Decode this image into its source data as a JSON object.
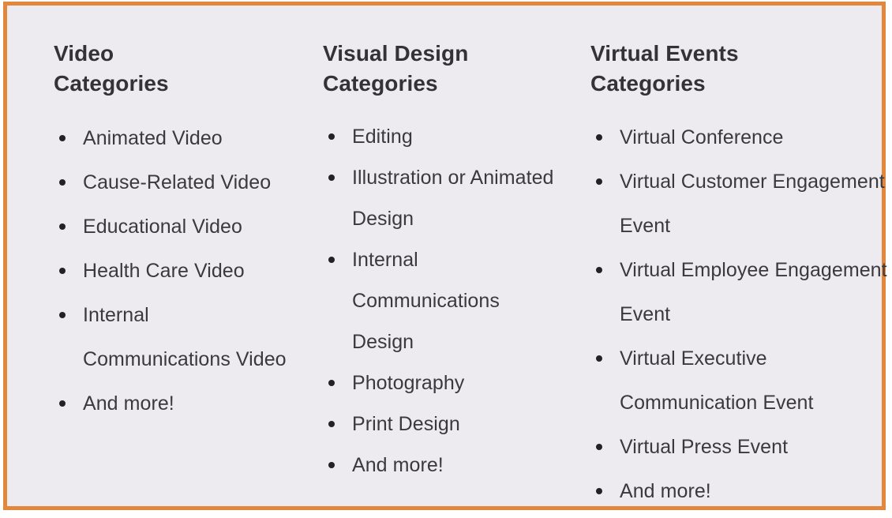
{
  "panel": {
    "border_color": "#e3873c",
    "background_color": "#edebf0",
    "text_color": "#3a3a3d",
    "heading_color": "#333337",
    "bullet_color": "#222225"
  },
  "columns": [
    {
      "heading": "Video Categories",
      "items": [
        "Animated Video",
        "Cause-Related Video",
        "Educational Video",
        "Health Care Video",
        "Internal Communications Video",
        "And more!"
      ]
    },
    {
      "heading": "Visual Design Categories",
      "items": [
        "Editing",
        "Illustration or Animated Design",
        "Internal Communications Design",
        "Photography",
        "Print Design",
        "And more!"
      ]
    },
    {
      "heading": "Virtual Events Categories",
      "items": [
        "Virtual Conference",
        "Virtual Customer Engagement Event",
        "Virtual Employee Engagement Event",
        "Virtual Executive Communication Event",
        "Virtual Press Event",
        "And more!"
      ]
    }
  ]
}
